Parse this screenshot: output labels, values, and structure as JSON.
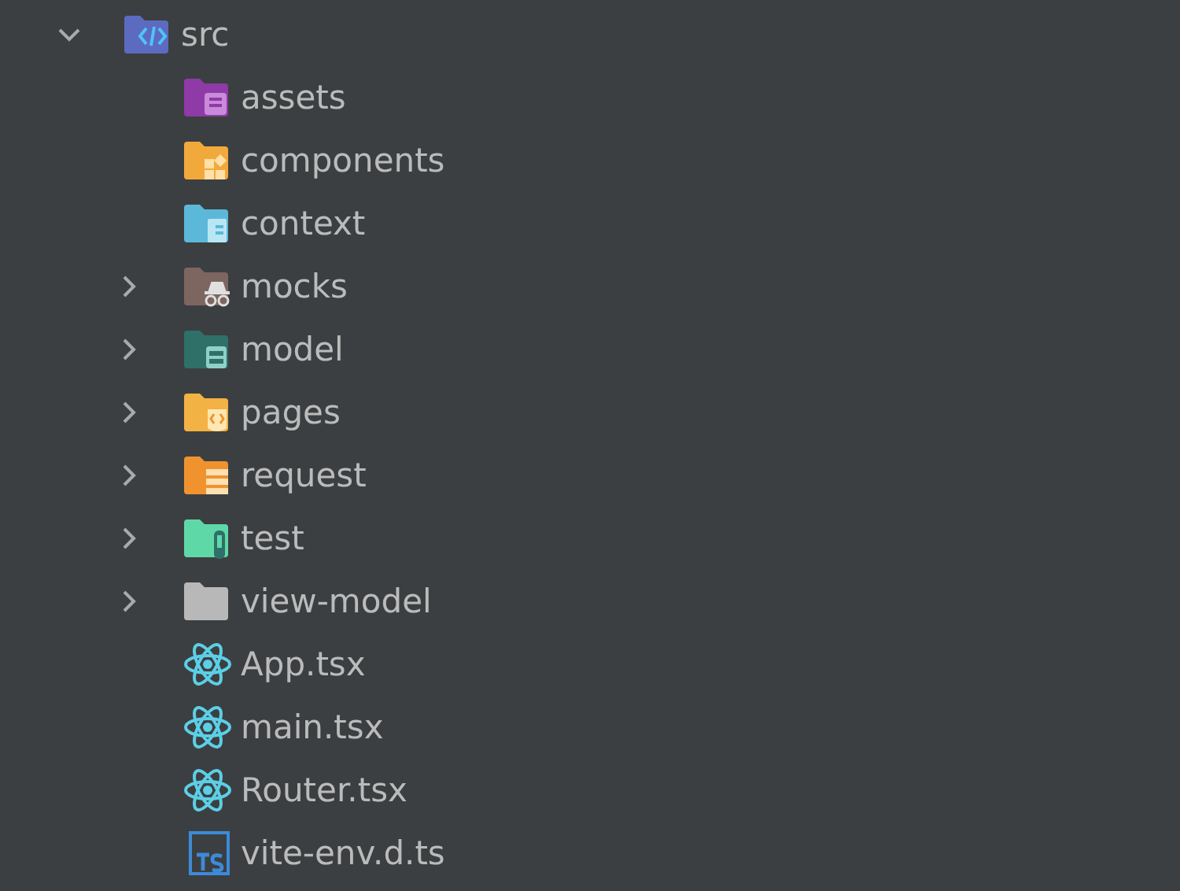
{
  "tree": [
    {
      "name": "src",
      "kind": "source",
      "color": "#5c6bc0",
      "expanded": true,
      "children": [
        {
          "name": "assets",
          "kind": "assets",
          "color": "#8e3aa7"
        },
        {
          "name": "components",
          "kind": "components",
          "color": "#f2a93b"
        },
        {
          "name": "context",
          "kind": "context",
          "color": "#5bb8d8"
        },
        {
          "name": "mocks",
          "kind": "mocks",
          "color": "#7d6660",
          "expanded": false
        },
        {
          "name": "model",
          "kind": "model",
          "color": "#2f7069",
          "expanded": false
        },
        {
          "name": "pages",
          "kind": "pages",
          "color": "#f3b244",
          "expanded": false
        },
        {
          "name": "request",
          "kind": "request",
          "color": "#f0932f",
          "expanded": false
        },
        {
          "name": "test",
          "kind": "test",
          "color": "#5fd8a8",
          "expanded": false
        },
        {
          "name": "view-model",
          "kind": "folder",
          "color": "#b8b8b8",
          "expanded": false
        },
        {
          "name": "App.tsx",
          "kind": "react"
        },
        {
          "name": "main.tsx",
          "kind": "react"
        },
        {
          "name": "Router.tsx",
          "kind": "react"
        },
        {
          "name": "vite-env.d.ts",
          "kind": "typescript"
        }
      ]
    }
  ]
}
